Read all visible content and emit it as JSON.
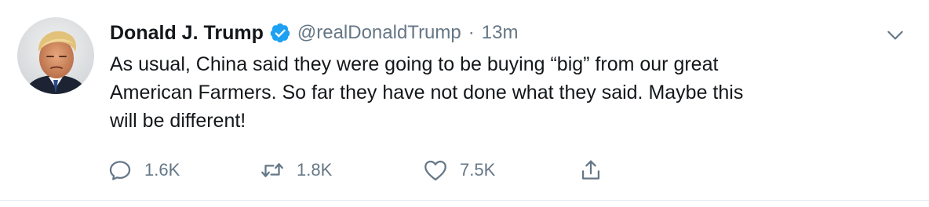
{
  "tweet": {
    "author": {
      "name": "Donald J. Trump",
      "handle": "@realDonaldTrump",
      "verified": true,
      "separator": "·",
      "time": "13m"
    },
    "text": "As usual, China said they were going to be buying “big” from our great\nAmerican Farmers. So far they have not done what they said. Maybe this\nwill be different!",
    "actions": {
      "reply_count": "1.6K",
      "retweet_count": "1.8K",
      "like_count": "7.5K"
    }
  },
  "icons": {
    "avatar": "avatar-photo",
    "verified": "verified-badge-icon",
    "caret": "chevron-down-icon",
    "reply": "reply-icon",
    "retweet": "retweet-icon",
    "like": "heart-icon",
    "share": "share-icon"
  },
  "colors": {
    "text": "#14171a",
    "secondary": "#657786",
    "verified": "#1da1f2",
    "divider": "#e6ecf0"
  }
}
